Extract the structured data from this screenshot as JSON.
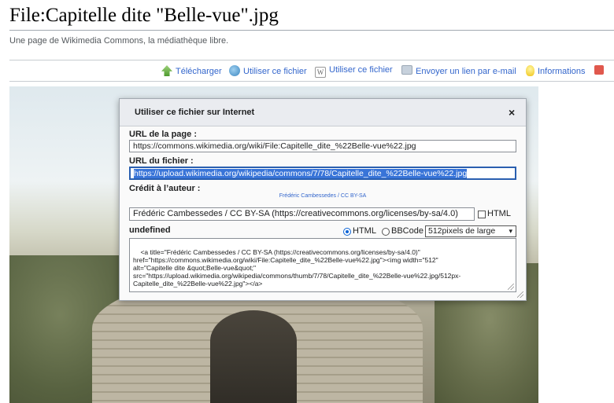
{
  "page": {
    "title": "File:Capitelle dite \"Belle-vue\".jpg",
    "tagline": "Une page de Wikimedia Commons, la médiathèque libre."
  },
  "toolbar": {
    "download": "Télécharger",
    "use_web": "Utiliser ce fichier",
    "use_wiki": "Utiliser ce fichier",
    "email": "Envoyer un lien par e-mail",
    "info": "Informations"
  },
  "dialog": {
    "title": "Utiliser ce fichier sur Internet",
    "close": "×",
    "page_url_label": "URL de la page :",
    "page_url": "https://commons.wikimedia.org/wiki/File:Capitelle_dite_%22Belle-vue%22.jpg",
    "file_url_label": "URL du fichier :",
    "file_url": "https://upload.wikimedia.org/wikipedia/commons/7/78/Capitelle_dite_%22Belle-vue%22.jpg",
    "credit_label": "Crédit à l’auteur :",
    "credit_preview": "Frédéric Cambessedes / CC BY-SA",
    "credit_text": "Frédéric Cambessedes / CC BY-SA (https://creativecommons.org/licenses/by-sa/4.0)",
    "credit_html_label": "HTML",
    "embed_label": "undefined",
    "format_html": "HTML",
    "format_bbcode": "BBCode",
    "size_selected": "512pixels de large",
    "embed_code": "<a title=\"Frédéric Cambessedes / CC BY-SA (https://creativecommons.org/licenses/by-sa/4.0)\"\nhref=\"https://commons.wikimedia.org/wiki/File:Capitelle_dite_%22Belle-vue%22.jpg\"><img width=\"512\"\nalt=\"Capitelle dite &quot;Belle-vue&quot;\"\nsrc=\"https://upload.wikimedia.org/wikipedia/commons/thumb/7/78/Capitelle_dite_%22Belle-vue%22.jpg/512px-\nCapitelle_dite_%22Belle-vue%22.jpg\"></a>"
  },
  "colors": {
    "link": "#3366cc",
    "selection": "#3874d8"
  }
}
